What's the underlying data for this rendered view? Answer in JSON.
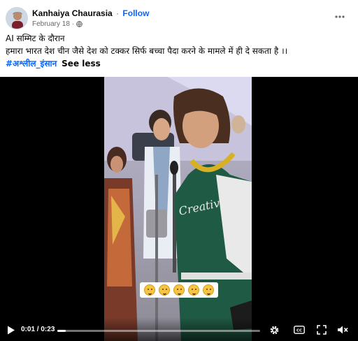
{
  "post": {
    "author": "Kanhaiya Chaurasia",
    "separator": "·",
    "follow_label": "Follow",
    "date": "February 18",
    "date_separator": "·",
    "audience_icon": "globe-icon",
    "more_icon": "more-horizontal-icon"
  },
  "caption": {
    "line1": "AI सम्मिट के दौरान",
    "line2": "हमारा भारत देश चीन जैसे देश को टक्कर सिर्फ बच्चा पैदा करने के मामले में ही दे सकता है ।।",
    "hashtag": "#अश्लील_इंसान",
    "see_less": "See less"
  },
  "video": {
    "current_time": "0:01",
    "time_separator": " / ",
    "duration": "0:23",
    "progress_fraction": 0.04,
    "overlay_emojis": [
      "face-emoji",
      "face-emoji",
      "face-emoji",
      "face-emoji",
      "face-emoji"
    ],
    "controls": {
      "play_icon": "play-icon",
      "settings_icon": "settings-gear-icon",
      "captions_icon": "closed-captions-icon",
      "fullscreen_icon": "fullscreen-icon",
      "mute_icon": "muted-speaker-icon"
    }
  },
  "colors": {
    "accent": "#0866ff",
    "text": "#050505",
    "secondary_text": "#65676b",
    "video_bg": "#000000"
  }
}
